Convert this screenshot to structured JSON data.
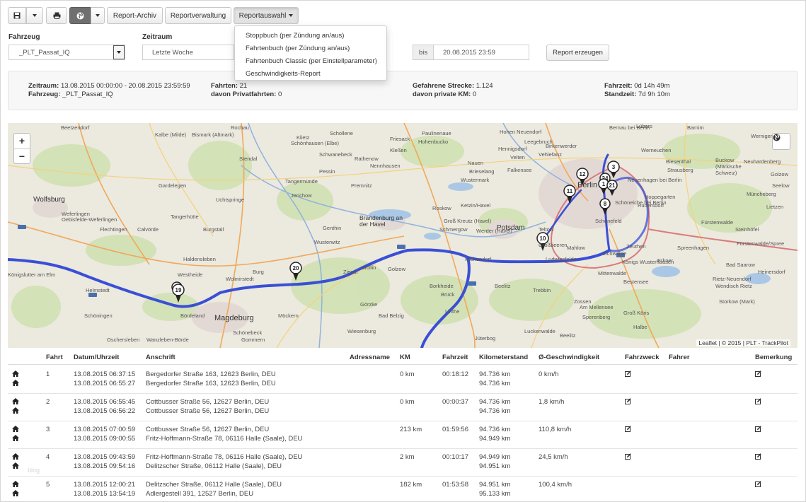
{
  "toolbar": {
    "save_icon": "save-icon",
    "print_icon": "print-icon",
    "globe_icon": "globe-icon",
    "report_archive": "Report-Archiv",
    "report_management": "Reportverwaltung",
    "report_selection": "Reportauswahl"
  },
  "report_menu": {
    "items": [
      "Stoppbuch (per Zündung an/aus)",
      "Fahrtenbuch (per Zündung an/aus)",
      "Fahrtenbuch Classic (per Einstellparameter)",
      "Geschwindigkeits-Report"
    ]
  },
  "form": {
    "vehicle_label": "Fahrzeug",
    "vehicle_value": "_PLT_Passat_IQ",
    "period_label": "Zeitraum",
    "period_value": "Letzte Woche",
    "to_addon": "bis",
    "to_value": "20.08.2015 23:59",
    "generate_button": "Report erzeugen"
  },
  "summary": {
    "period_label": "Zeitraum:",
    "period_value": "13.08.2015 00:00:00 - 20.08.2015 23:59:59",
    "vehicle_label": "Fahrzeug:",
    "vehicle_value": "_PLT_Passat_IQ",
    "trips_label": "Fahrten:",
    "trips_value": "21",
    "private_trips_label": "davon Privatfahrten:",
    "private_trips_value": "0",
    "distance_label": "Gefahrene Strecke:",
    "distance_value": "1.124",
    "private_km_label": "davon private KM:",
    "private_km_value": "0",
    "drive_time_label": "Fahrzeit:",
    "drive_time_value": "0d 14h 49m",
    "idle_time_label": "Standzeit:",
    "idle_time_value": "7d 9h 10m"
  },
  "map": {
    "attribution": "Leaflet | © 2015 | PLT - TrackPilot",
    "zoom_in": "+",
    "zoom_out": "−",
    "route_color": "#3a4fd6",
    "places": [
      "Beetzendorf",
      "Rochau",
      "Klietz",
      "Schollene",
      "Paulinenaue",
      "Hohen Neuendorf",
      "Bernau bei Berlin",
      "Kalbe (Milde)",
      "Bismark (Altmark)",
      "Wernigerode",
      "Schönhausen (Elbe)",
      "Rathenow",
      "Nauen",
      "Falkensee",
      "Hennigsdorf",
      "Berlin",
      "Wolfsburg",
      "Gardelegen",
      "Stendal",
      "Tangermünde",
      "Premnitz",
      "Brandenburg an der Havel",
      "Potsdam",
      "Teltow",
      "Großbeeren",
      "Werder (Havel)",
      "Genthin",
      "Burg",
      "Magdeburg",
      "Ziesar",
      "Wollin",
      "Golzow",
      "Michendorf",
      "Beelitz",
      "Trebbin",
      "Königs Wusterhausen",
      "Zossen",
      "Mittenwalde",
      "Haldensleben",
      "Westheide",
      "Flechtingen",
      "Wolmirstedt",
      "Bördeland",
      "Schönebeck",
      "Gommern",
      "Möckern",
      "Bad Belzig",
      "Wiesenburg",
      "Luckenwalde",
      "Jüterbog",
      "Fürstenwalde/Spree",
      "Storkow (Mark)",
      "Erkner",
      "Hoppegarten",
      "Neuenhagen bei Berlin",
      "Strausberg",
      "Helmstedt",
      "Schöningen",
      "Oschersleben",
      "Wanzleben-Börde",
      "Calvörde",
      "Weferlingen",
      "Oebisfelde-Weferlingen",
      "Königslutter am Elm",
      "Tangerhütte",
      "Burgstall",
      "Uchtspringe",
      "Lübars",
      "Wustermark",
      "Ketzin/Havel",
      "Roskow",
      "Groß Kreutz (Havel)",
      "Nennhausen",
      "Jerichow",
      "Wusterwitz",
      "Borkheide",
      "Brück",
      "Görzke",
      "Linthe",
      "Halbe",
      "Bestensee",
      "Groß Köris",
      "Eichwalde",
      "Zeuthen",
      "Rüdersdorf",
      "Spreenhagen",
      "Bad Saarow",
      "Wendisch Rietz",
      "Heinersdorf",
      "Rietz-Neuendorf",
      "Schönefeld",
      "Schöneiche bei Berlin",
      "Barnim",
      "Buckow (Märkische Schweiz)",
      "Neuhardenberg",
      "Werneuchen",
      "Golzow",
      "Seelow",
      "Müncheberg",
      "Lietzen",
      "Steinhöfel",
      "Fürstenwalde",
      "Beelitz",
      "Am Mellensee",
      "Sperenberg",
      "Schmergow",
      "Biesenthal",
      "Pessin",
      "Kleßen",
      "Hohenbucko",
      "Friesack",
      "Vehlefanz",
      "Schwanebeck",
      "Mahlow",
      "Ludwigsfelde",
      "Velten",
      "Brieselang",
      "Leegebruch",
      "Birkenwerder"
    ],
    "markers": [
      "3",
      "12",
      "24",
      "1",
      "21",
      "11",
      "8",
      "10",
      "20",
      "19"
    ]
  },
  "table": {
    "headers": [
      "Fahrt",
      "Datum/Uhrzeit",
      "Anschrift",
      "Adressname",
      "KM",
      "Fahrzeit",
      "Kilometerstand",
      "Ø-Geschwindigkeit",
      "Fahrzweck",
      "Fahrer",
      "Bemerkung"
    ],
    "rows": [
      {
        "trip": "1",
        "dt1": "13.08.2015 06:37:15",
        "dt2": "13.08.2015 06:55:27",
        "addr1": "Bergedorfer Straße 163, 12623 Berlin, DEU",
        "addr2": "Bergedorfer Straße 163, 12623 Berlin, DEU",
        "km": "0 km",
        "time": "00:18:12",
        "odo1": "94.736 km",
        "odo2": "94.736 km",
        "speed": "0 km/h"
      },
      {
        "trip": "2",
        "dt1": "13.08.2015 06:55:45",
        "dt2": "13.08.2015 06:56:22",
        "addr1": "Cottbusser Straße 56, 12627 Berlin, DEU",
        "addr2": "Cottbusser Straße 56, 12627 Berlin, DEU",
        "km": "0 km",
        "time": "00:00:37",
        "odo1": "94.736 km",
        "odo2": "94.736 km",
        "speed": "1,8 km/h"
      },
      {
        "trip": "3",
        "dt1": "13.08.2015 07:00:59",
        "dt2": "13.08.2015 09:00:55",
        "addr1": "Cottbusser Straße 56, 12627 Berlin, DEU",
        "addr2": "Fritz-Hoffmann-Straße 78, 06116 Halle (Saale), DEU",
        "km": "213 km",
        "time": "01:59:56",
        "odo1": "94.736 km",
        "odo2": "94.949 km",
        "speed": "110,8 km/h"
      },
      {
        "trip": "4",
        "dt1": "13.08.2015 09:43:59",
        "dt2": "13.08.2015 09:54:16",
        "addr1": "Fritz-Hoffmann-Straße 78, 06116 Halle (Saale), DEU",
        "addr2": "Delitzscher Straße, 06112 Halle (Saale), DEU",
        "km": "2 km",
        "time": "00:10:17",
        "odo1": "94.949 km",
        "odo2": "94.951 km",
        "speed": "24,5 km/h"
      },
      {
        "trip": "5",
        "dt1": "13.08.2015 12:00:21",
        "dt2": "13.08.2015 13:54:19",
        "addr1": "Delitzscher Straße, 06112 Halle (Saale), DEU",
        "addr2": "Adlergestell 391, 12527 Berlin, DEU",
        "km": "182 km",
        "time": "01:53:58",
        "odo1": "94.951 km",
        "odo2": "95.133 km",
        "speed": "100,4 km/h"
      }
    ]
  },
  "watermark": "blog"
}
